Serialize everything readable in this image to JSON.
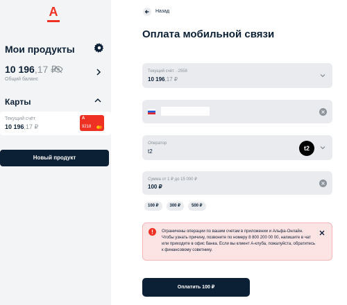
{
  "brand": {
    "logo_letter": "А",
    "accent": "#ef3124"
  },
  "sidebar": {
    "products_title": "Мои продукты",
    "balance_main": "10 196",
    "balance_cents": ",17 ₽",
    "balance_label": "Общий баланс",
    "cards_title": "Карты",
    "card": {
      "label": "Текущий счёт",
      "amount_main": "10 196",
      "amount_cents": ",17 ₽",
      "thumb_letter": "А",
      "thumb_number": "9218"
    },
    "new_product_label": "Новый продукт"
  },
  "main": {
    "back_label": "Назад",
    "title": "Оплата мобильной связи",
    "account": {
      "label": "Текущий счёт ··2558",
      "amount_main": "10 196",
      "amount_cents": ",17 ₽"
    },
    "phone": {
      "value": ""
    },
    "operator": {
      "label": "Оператор",
      "value": "t2",
      "logo_text": "t2"
    },
    "sum": {
      "label": "Сумма от 1 ₽ до 15 000 ₽",
      "value": "100 ₽"
    },
    "chips": [
      "100 ₽",
      "300 ₽",
      "500 ₽"
    ],
    "alert": {
      "text": "Ограничены операции по вашим счетам в приложении и Альфа-Онлайн. Чтобы узнать причину, позвоните по номеру 8 800 200 00 00, напишите в чат или приходите в офис банка. Если вы клиент А-клуба, пожалуйста, обратитесь к финансовому советнику."
    },
    "pay_label": "Оплатить 100 ₽"
  },
  "icons": [
    "gear-icon",
    "eye-off-icon",
    "chevron-right-icon",
    "chevron-up-icon",
    "arrow-left-icon",
    "chevron-down-icon",
    "russia-flag-icon",
    "clear-icon",
    "alert-icon",
    "close-icon"
  ]
}
